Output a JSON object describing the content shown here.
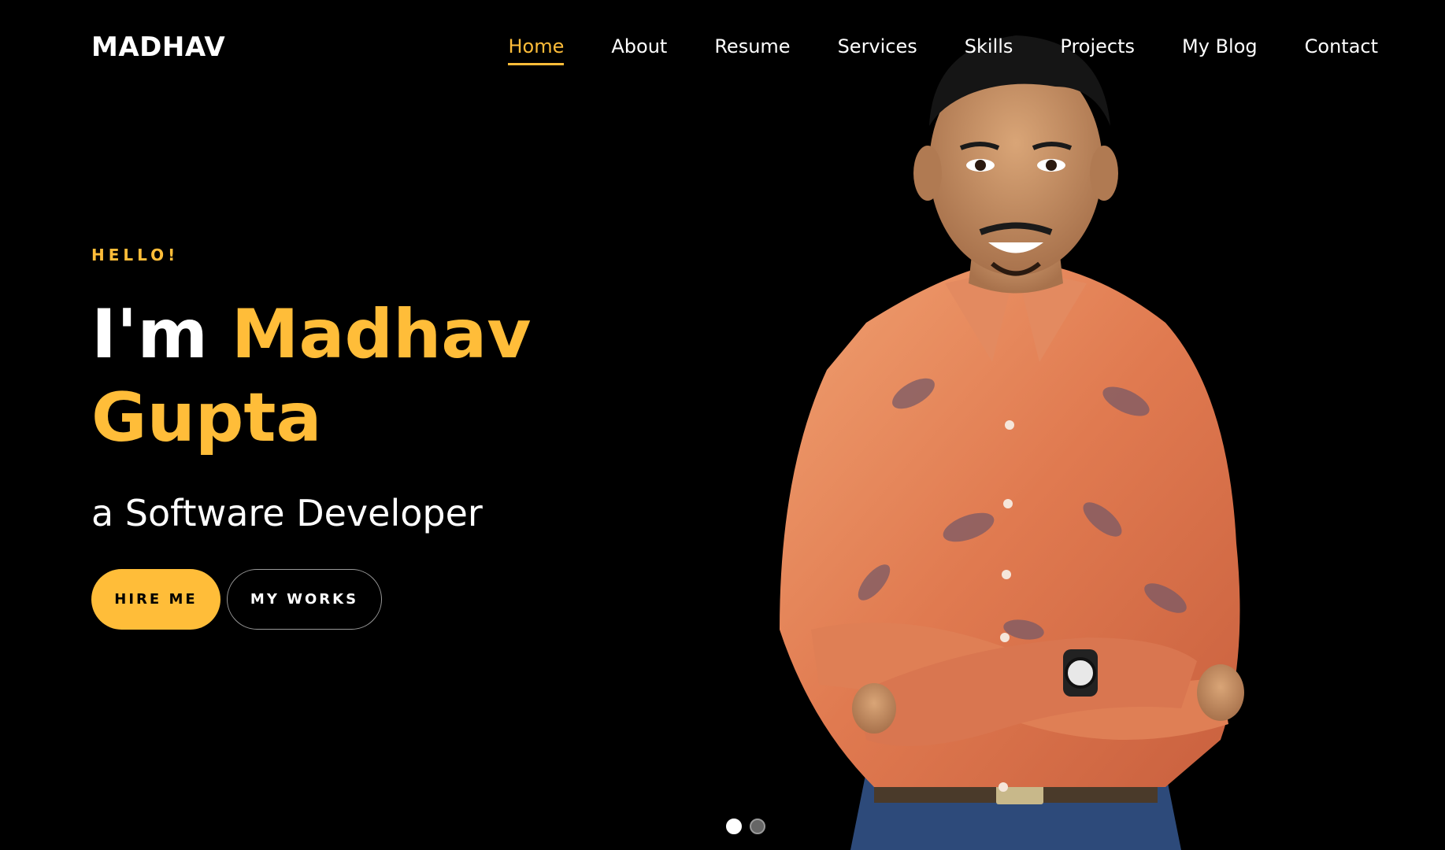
{
  "brand": {
    "logo": "MADHAV",
    "accent_color": "#ffbd39"
  },
  "nav": {
    "items": [
      {
        "label": "Home",
        "active": true
      },
      {
        "label": "About"
      },
      {
        "label": "Resume"
      },
      {
        "label": "Services"
      },
      {
        "label": "Skills"
      },
      {
        "label": "Projects"
      },
      {
        "label": "My Blog"
      },
      {
        "label": "Contact"
      }
    ]
  },
  "hero": {
    "greeting": "HELLO!",
    "headline_prefix": "I'm",
    "headline_name_first": "Madhav",
    "headline_name_last": "Gupta",
    "subtitle": "a Software Developer",
    "hire_button": "HIRE ME",
    "works_button": "MY WORKS"
  },
  "slider": {
    "count": 2,
    "active_index": 0
  }
}
